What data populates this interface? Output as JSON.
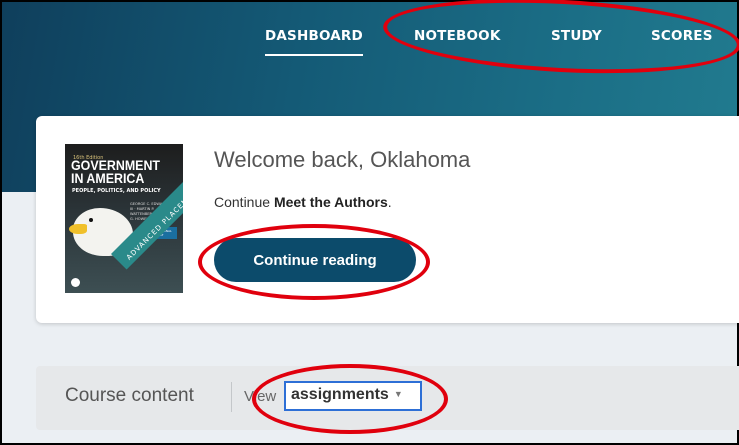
{
  "nav": {
    "items": [
      {
        "label": "DASHBOARD",
        "active": true
      },
      {
        "label": "NOTEBOOK",
        "active": false
      },
      {
        "label": "STUDY",
        "active": false
      },
      {
        "label": "SCORES",
        "active": false
      }
    ]
  },
  "book": {
    "edition": "16th Edition",
    "title_line1": "GOVERNMENT",
    "title_line2": "IN AMERICA",
    "subtitle": "PEOPLE, POLITICS, AND POLICY",
    "authors": "GEORGE C. EDWARDS III · MARTIN P. WATTENBERG · WILLIAM G. HOWELL",
    "badge": "AP® PROFESSIONAL DEVELOPMENT EDITION",
    "placement_text": "ADVANCED PLACEMENT"
  },
  "welcome": {
    "heading": "Welcome back, Oklahoma",
    "continue_prefix": "Continue",
    "continue_item": "Meet the Authors",
    "continue_suffix": ".",
    "button_label": "Continue reading"
  },
  "course": {
    "label": "Course content",
    "view_label": "View",
    "selected_view": "assignments"
  },
  "colors": {
    "header": "#145a76",
    "button": "#0c4b6b",
    "annotation": "#e0000d",
    "select_border": "#2d6fd6"
  }
}
